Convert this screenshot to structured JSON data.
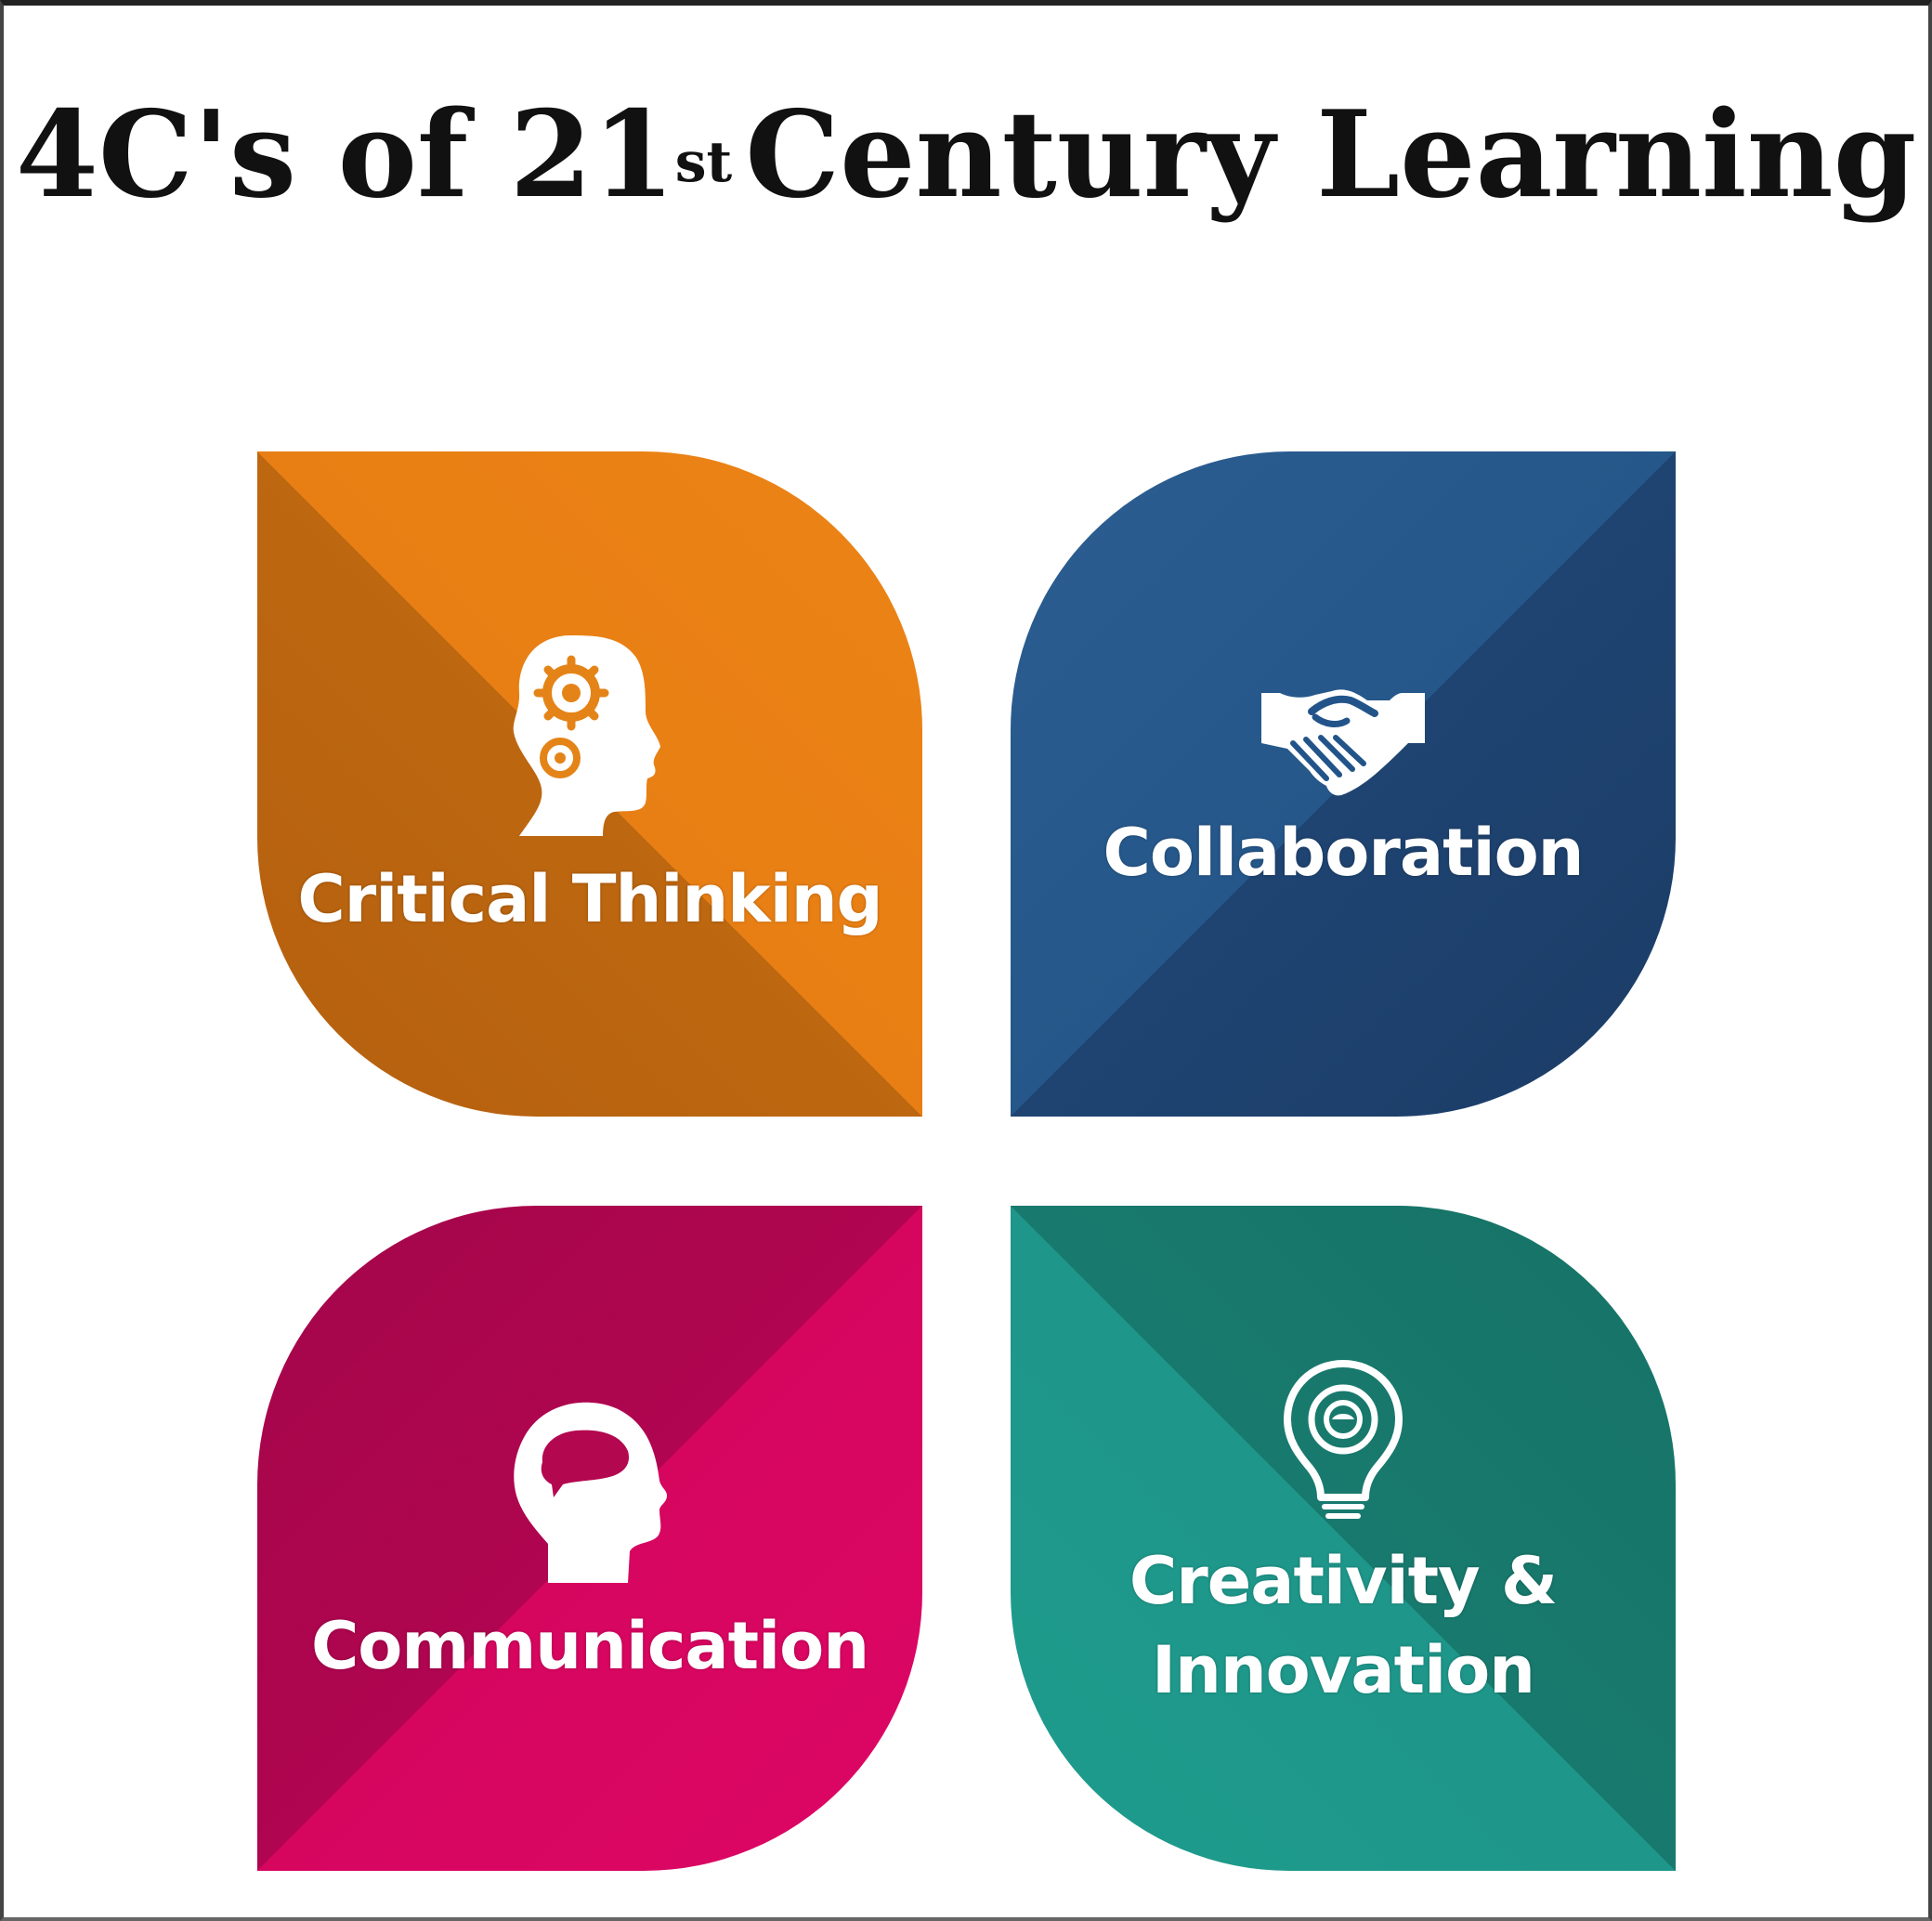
{
  "title": {
    "main": "4C's of 21",
    "superscript": "st",
    "rest": "Century Learning"
  },
  "quadrants": [
    {
      "label": "Critical Thinking",
      "icon": "head-gears-icon",
      "color": "#e87f14"
    },
    {
      "label": "Collaboration",
      "icon": "handshake-icon",
      "color": "#1f4472"
    },
    {
      "label": "Communication",
      "icon": "head-speech-icon",
      "color": "#d6065f"
    },
    {
      "label_line1": "Creativity &",
      "label_line2": "Innovation",
      "icon": "lightbulb-icon",
      "color": "#1e968a"
    }
  ]
}
